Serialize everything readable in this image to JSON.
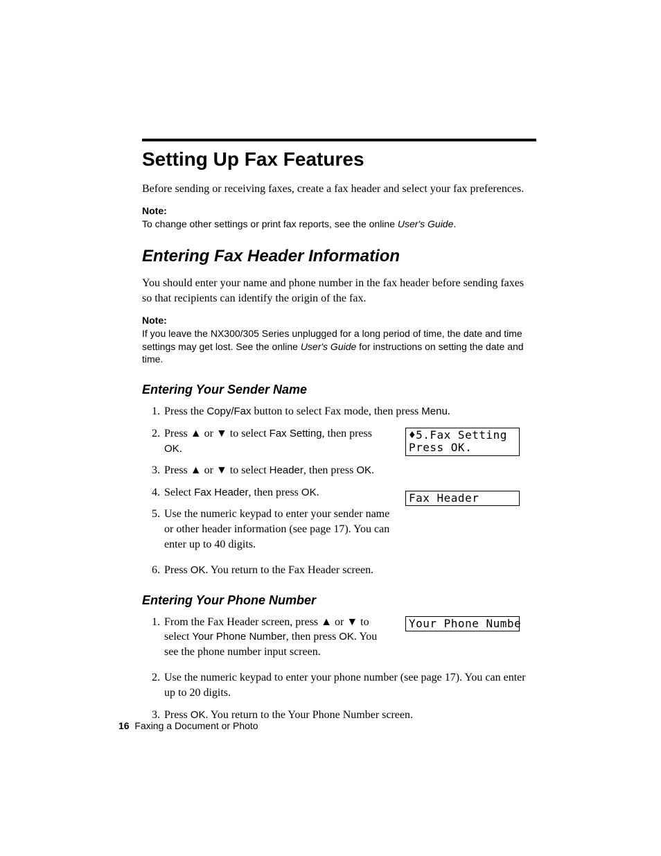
{
  "page": {
    "number": "16",
    "section": "Faxing a Document or Photo"
  },
  "h1": "Setting Up Fax Features",
  "intro": "Before sending or receiving faxes, create a fax header and select your fax preferences.",
  "note1": {
    "label": "Note:",
    "text_a": "To change other settings or print fax reports, see the online ",
    "text_b_italic": "User's Guide",
    "text_c": "."
  },
  "h2": "Entering Fax Header Information",
  "para2": "You should enter your name and phone number in the fax header before sending faxes so that recipients can identify the origin of the fax.",
  "note2": {
    "label": "Note:",
    "text_a": "If you leave the NX300/305 Series unplugged for a long period of time, the date and time settings may get lost. See the online ",
    "text_b_italic": "User's Guide",
    "text_c": " for instructions on setting the date and time."
  },
  "section_sender": {
    "heading": "Entering Your Sender Name",
    "step1_a": "Press the ",
    "step1_b_sans": "Copy/Fax",
    "step1_c": " button to select Fax mode, then press ",
    "step1_d_sans": "Menu",
    "step1_e": ".",
    "step2_a": "Press ",
    "step2_b_tri": "▲",
    "step2_c": " or ",
    "step2_d_tri": "▼",
    "step2_e": " to select ",
    "step2_f_sans": "Fax Setting",
    "step2_g": ", then press ",
    "step2_h_sans": "OK",
    "step2_i": ".",
    "step3_a": "Press ",
    "step3_b_tri": "▲",
    "step3_c": " or ",
    "step3_d_tri": "▼",
    "step3_e": " to select ",
    "step3_f_sans": "Header",
    "step3_g": ", then press ",
    "step3_h_sans": "OK",
    "step3_i": ".",
    "step4_a": "Select ",
    "step4_b_sans": "Fax Header",
    "step4_c": ", then press ",
    "step4_d_sans": "OK",
    "step4_e": ".",
    "step5": "Use the numeric keypad to enter your sender name or other header information (see page 17). You can enter up to 40 digits.",
    "step6_a": "Press ",
    "step6_b_sans": "OK",
    "step6_c": ". You return to the Fax Header screen.",
    "lcd1": "♦5.Fax Setting\nPress OK.",
    "lcd2": "Fax Header"
  },
  "section_phone": {
    "heading": "Entering Your Phone Number",
    "step1_a": "From the Fax Header screen, press ",
    "step1_b_tri": "▲",
    "step1_c": " or ",
    "step1_d_tri": "▼",
    "step1_e": " to select ",
    "step1_f_sans": "Your Phone Number",
    "step1_g": ", then press ",
    "step1_h_sans": "OK",
    "step1_i": ". You see the phone number input screen.",
    "step2": "Use the numeric keypad to enter your phone number (see page 17). You can enter up to 20 digits.",
    "step3_a": "Press ",
    "step3_b_sans": "OK",
    "step3_c": ". You return to the Your Phone Number screen.",
    "lcd": "Your Phone Numbe"
  }
}
